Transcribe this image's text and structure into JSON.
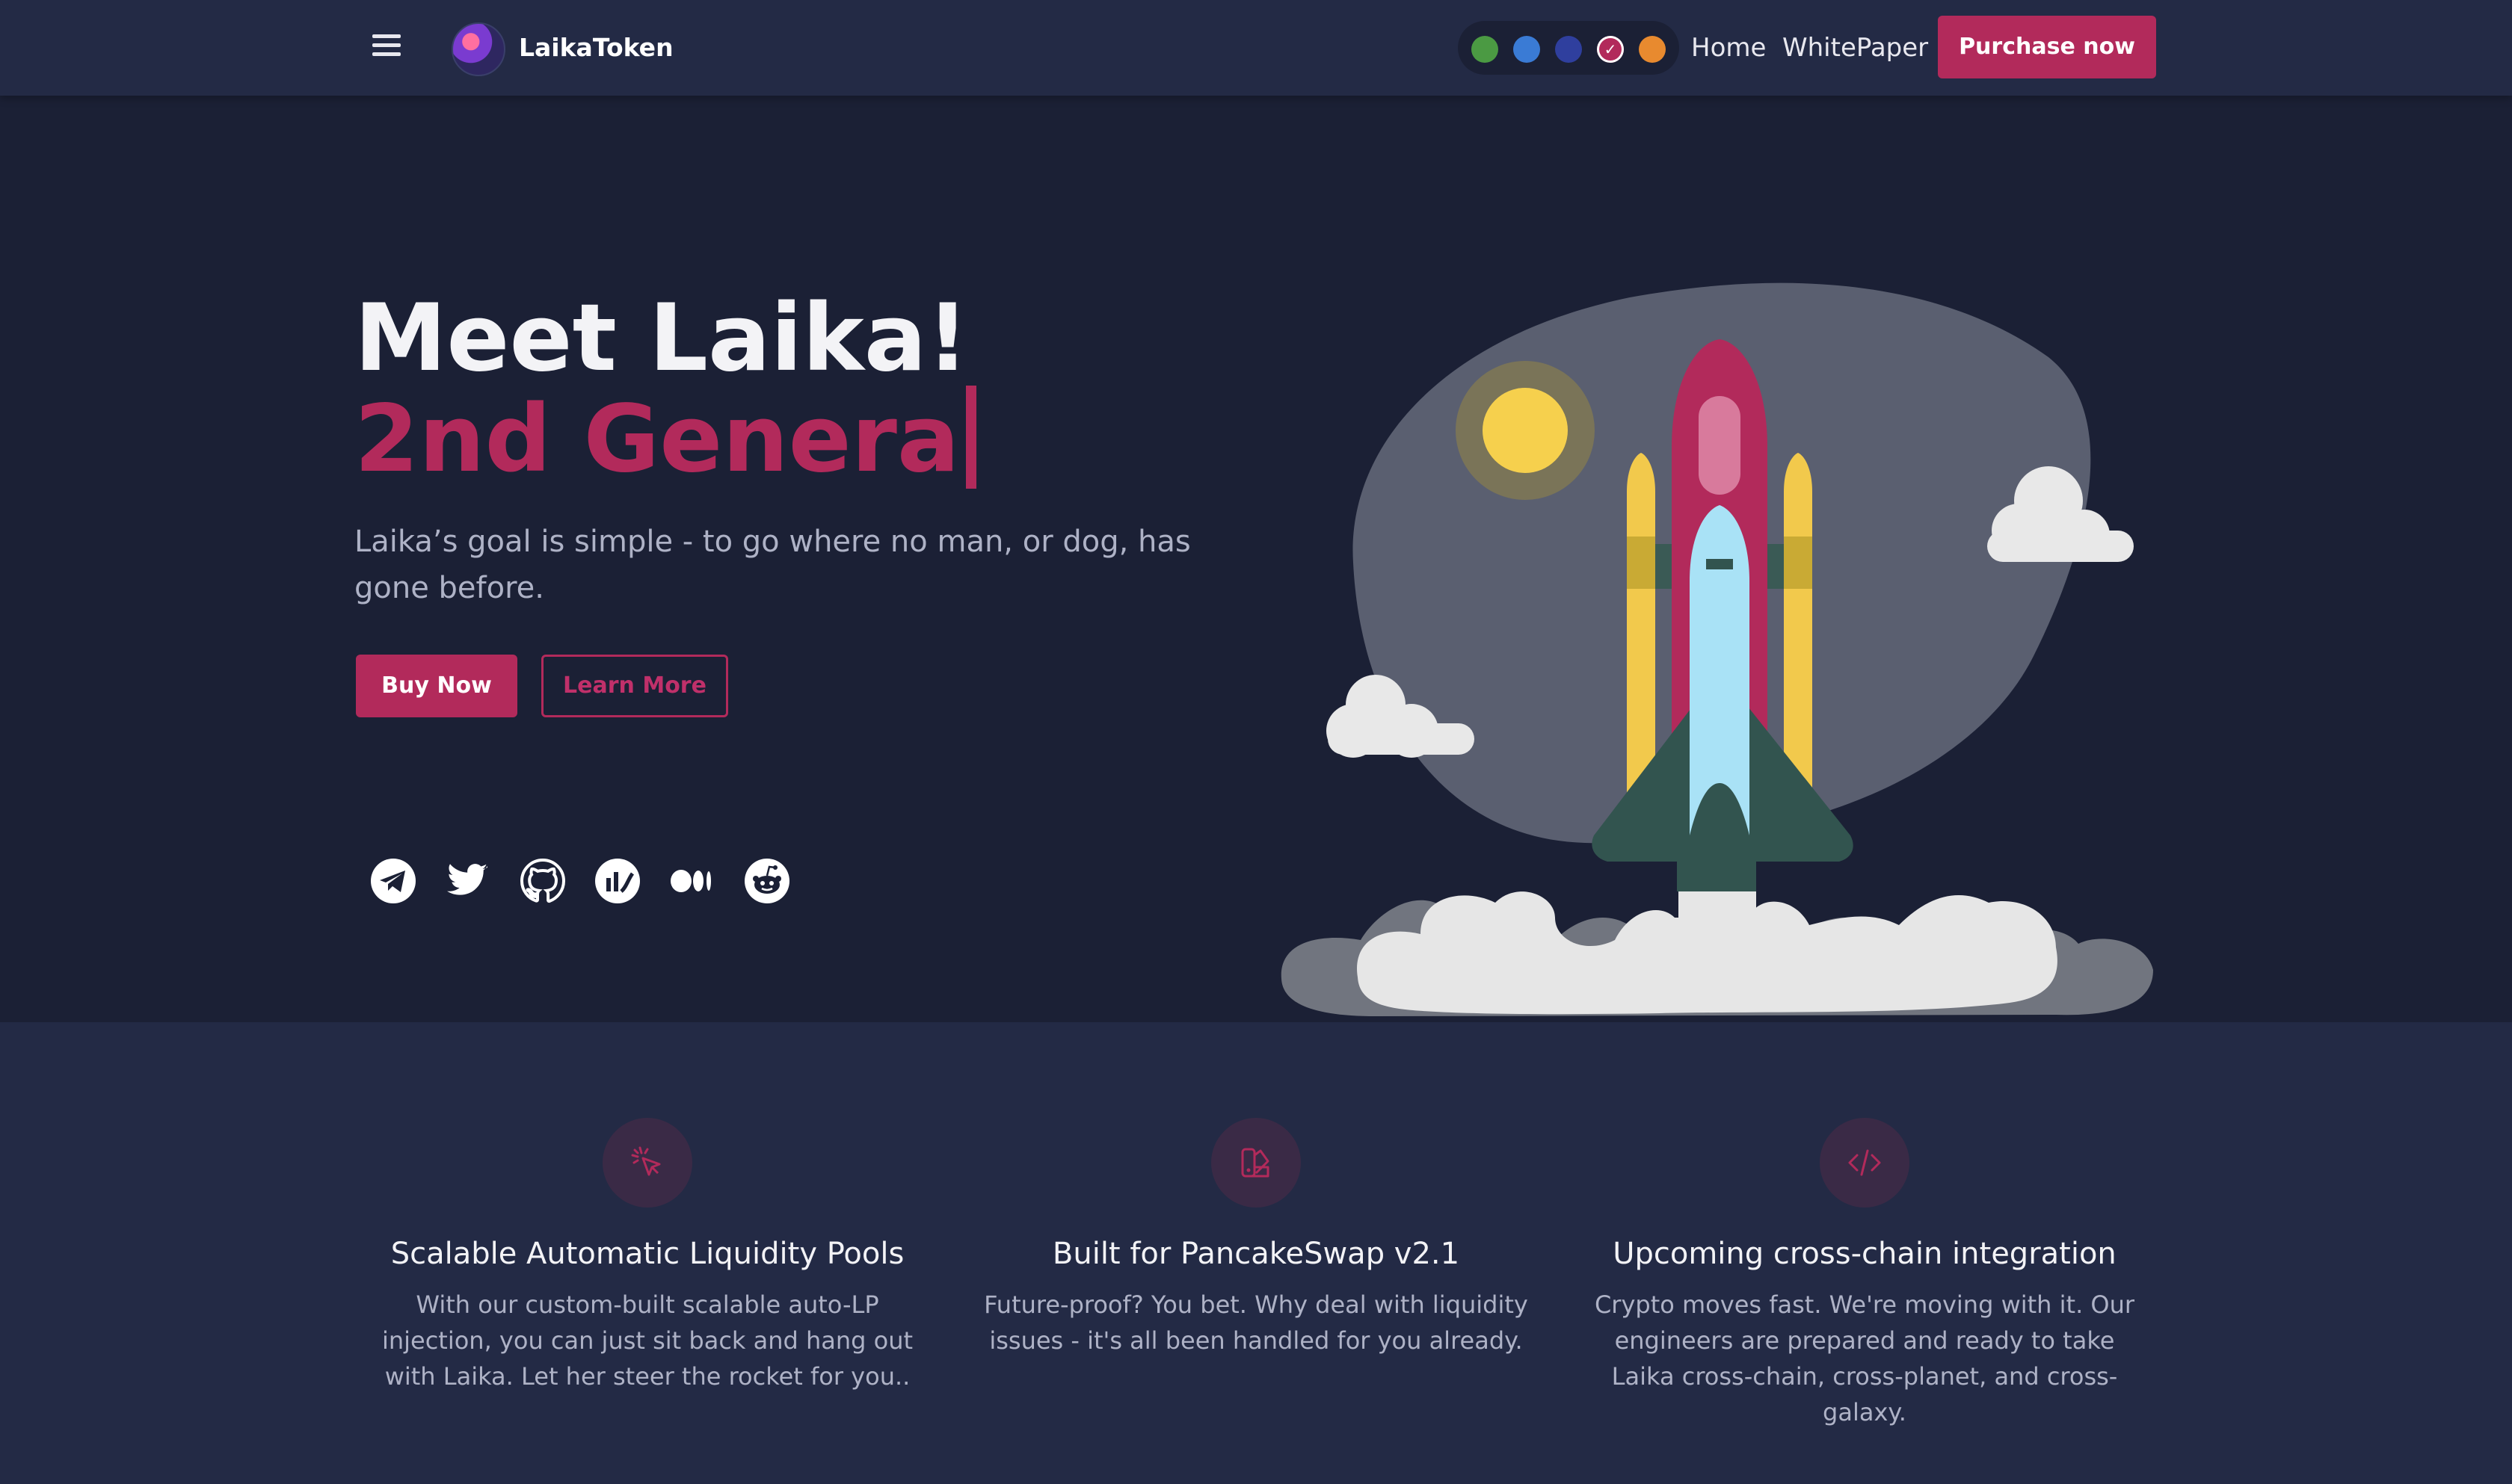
{
  "nav": {
    "menu_icon": "hamburger-menu-icon",
    "brand": "LaikaToken",
    "theme_colors": [
      "#4b9a43",
      "#3a7bd5",
      "#2f3f9e",
      "#b22a5b",
      "#e88a2f"
    ],
    "selected_theme": "#b22a5b",
    "links": [
      "Home",
      "WhitePaper"
    ],
    "cta": "Purchase now"
  },
  "hero": {
    "title": "Meet Laika!",
    "subtitle": "2nd Genera",
    "description": "Laika’s goal is simple - to go where no man, or dog, has gone before.",
    "buy_button": "Buy Now",
    "learn_button": "Learn More",
    "social_icons": [
      "telegram-icon",
      "twitter-icon",
      "github-icon",
      "chart-icon",
      "medium-icon",
      "reddit-icon"
    ]
  },
  "features": [
    {
      "icon": "cursor-click-icon",
      "title": "Scalable Automatic Liquidity Pools",
      "description": "With our custom-built scalable auto-LP injection, you can just sit back and hang out with Laika. Let her steer the rocket for you.."
    },
    {
      "icon": "swatch-icon",
      "title": "Built for PancakeSwap v2.1",
      "description": "Future-proof? You bet. Why deal with liquidity issues - it's all been handled for you already."
    },
    {
      "icon": "code-icon",
      "title": "Upcoming cross-chain integration",
      "description": "Crypto moves fast. We're moving with it. Our engineers are prepared and ready to take Laika cross-chain, cross-planet, and cross-galaxy."
    }
  ],
  "colors": {
    "accent": "#b22a5b",
    "nav_bg": "#232a45",
    "hero_bg": "#1b2035"
  }
}
